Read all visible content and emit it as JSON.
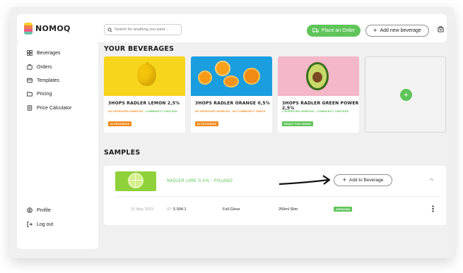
{
  "app": {
    "name": "NOMOQ"
  },
  "search": {
    "placeholder": "Search for anything you want..."
  },
  "header": {
    "place_order_label": "Place an Order",
    "add_beverage_label": "Add new beverage"
  },
  "sidebar": {
    "items": [
      {
        "label": "Beverages",
        "icon": "grid-icon"
      },
      {
        "label": "Orders",
        "icon": "bag-icon"
      },
      {
        "label": "Templates",
        "icon": "template-icon"
      },
      {
        "label": "Pricing",
        "icon": "folder-icon"
      },
      {
        "label": "Price Calculator",
        "icon": "calculator-icon"
      }
    ],
    "bottom": [
      {
        "label": "Profile",
        "icon": "user-icon"
      },
      {
        "label": "Log out",
        "icon": "logout-icon"
      }
    ]
  },
  "beverages": {
    "title": "YOUR BEVERAGES",
    "cards": [
      {
        "name": "3HOPS RADLER LEMON 2,5%",
        "samples": "NO APPROVED SAMPLES",
        "check": "COMMODITY CHECKED",
        "status": "IN PROGRESS",
        "samples_color": "#f08a1c",
        "check_color": "#5fc55a",
        "status_color": "#f08a1c"
      },
      {
        "name": "3HOPS RADLER ORANGE 0,5%",
        "samples": "NO APPROVED SAMPLES",
        "check": "NO COMMODITY CHECK",
        "status": "IN PROGRESS",
        "samples_color": "#f08a1c",
        "check_color": "#f08a1c",
        "status_color": "#f08a1c"
      },
      {
        "name": "3HOPS RADLER GREEN POWER 2,5%",
        "samples": "2 APPROVED SAMPLES",
        "check": "COMMODITY CHECKED",
        "status": "READY FOR ORDER",
        "samples_color": "#5fc55a",
        "check_color": "#5fc55a",
        "status_color": "#5fc55a"
      }
    ]
  },
  "samples": {
    "title": "SAMPLES",
    "item": {
      "name": "RADLER LIME 0,5% - POLAND",
      "add_label": "Add to Beverage",
      "date": "10 May 2023",
      "id_label": "ID:",
      "id": "S 004.1",
      "finish": "Full Gloss",
      "format": "250ml Slim",
      "status": "APPROVED"
    }
  },
  "colors": {
    "accent": "#5fc55a",
    "warning": "#f08a1c"
  }
}
